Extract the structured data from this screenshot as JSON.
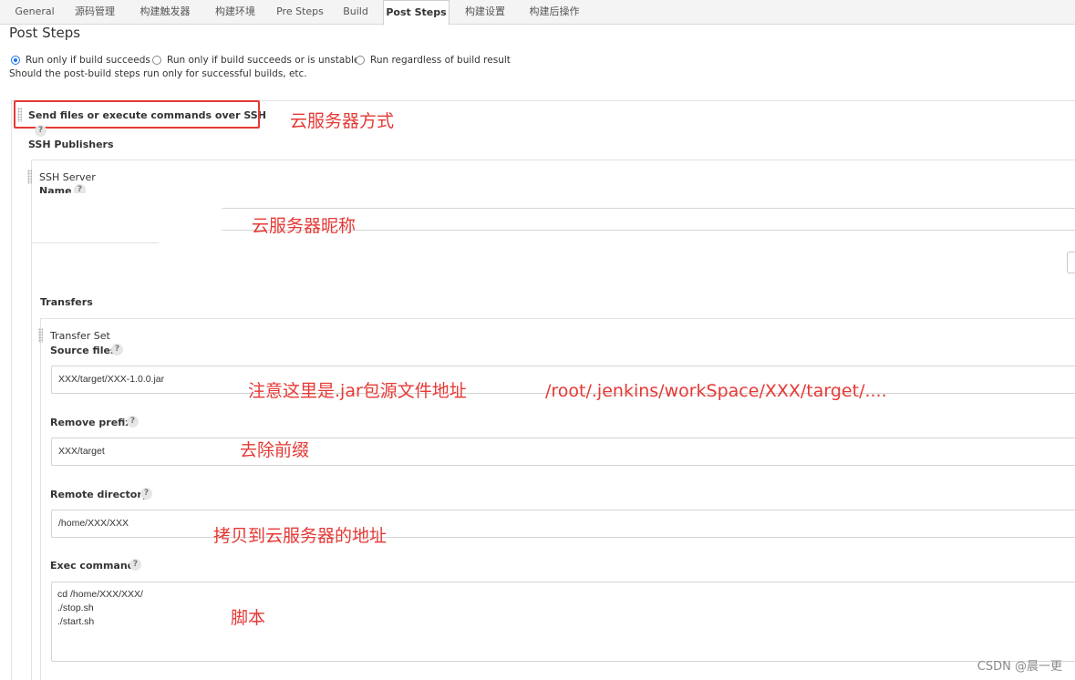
{
  "tabs": [
    "General",
    "源码管理",
    "构建触发器",
    "构建环境",
    "Pre Steps",
    "Build",
    "Post Steps",
    "构建设置",
    "构建后操作"
  ],
  "section": {
    "title": "Post Steps",
    "radio_options": [
      "Run only if build succeeds",
      "Run only if build succeeds or is unstable",
      "Run regardless of build result"
    ],
    "hint": "Should the post-build steps run only for successful builds, etc."
  },
  "ssh": {
    "step_title": "Send files or execute commands over SSH",
    "publishers_label": "SSH Publishers",
    "server_label": "SSH Server",
    "name_label": "Name",
    "name_value": "",
    "transfers_label": "Transfers",
    "transfer_set_label": "Transfer Set",
    "source_files_label": "Source files",
    "source_files_value": "XXX/target/XXX-1.0.0.jar",
    "remove_prefix_label": "Remove prefix",
    "remove_prefix_value": "XXX/target",
    "remote_directory_label": "Remote directory",
    "remote_directory_value": "/home/XXX/XXX",
    "exec_command_label": "Exec command",
    "exec_command_value": "cd /home/XXX/XXX/\n./stop.sh\n./start.sh",
    "help_glyph": "?"
  },
  "annotations": {
    "step_note": "云服务器方式",
    "name_note": "云服务器昵称",
    "source_note": "注意这里是.jar包源文件地址",
    "source_path_note": "/root/.jenkins/workSpace/XXX/target/....",
    "prefix_note": "去除前缀",
    "remote_note": "拷贝到云服务器的地址",
    "exec_note": "脚本"
  },
  "watermark": "CSDN @晨一更",
  "colors": {
    "annotation": "#e53935",
    "radio_selected": "#1a73e8"
  }
}
